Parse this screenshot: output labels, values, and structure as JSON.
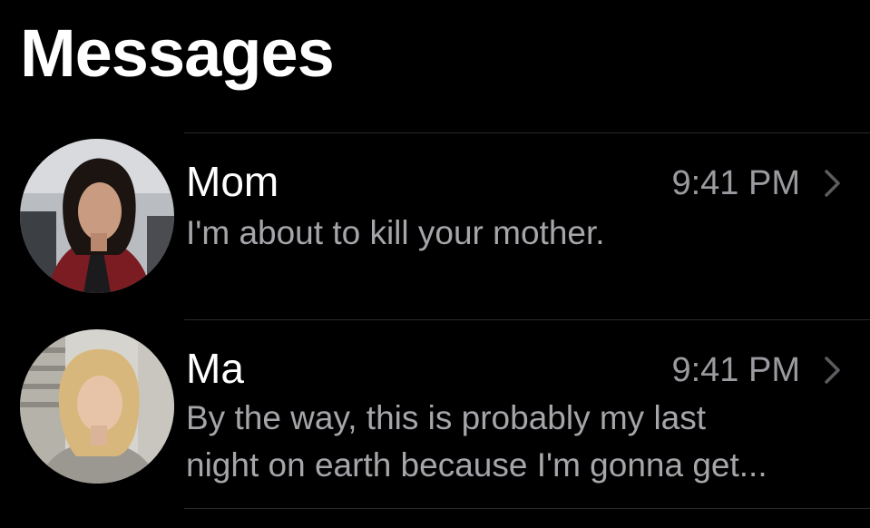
{
  "header": {
    "title": "Messages"
  },
  "conversations": [
    {
      "name": "Mom",
      "time": "9:41 PM",
      "preview": "I'm about to kill your mother."
    },
    {
      "name": "Ma",
      "time": "9:41 PM",
      "preview": "By the way, this is probably my last night on earth because I'm gonna get..."
    }
  ],
  "colors": {
    "background": "#000000",
    "primary_text": "#ffffff",
    "secondary_text": "#9a9a9f",
    "separator": "#2a2a2c"
  },
  "icons": {
    "disclosure": "chevron-right-icon"
  }
}
